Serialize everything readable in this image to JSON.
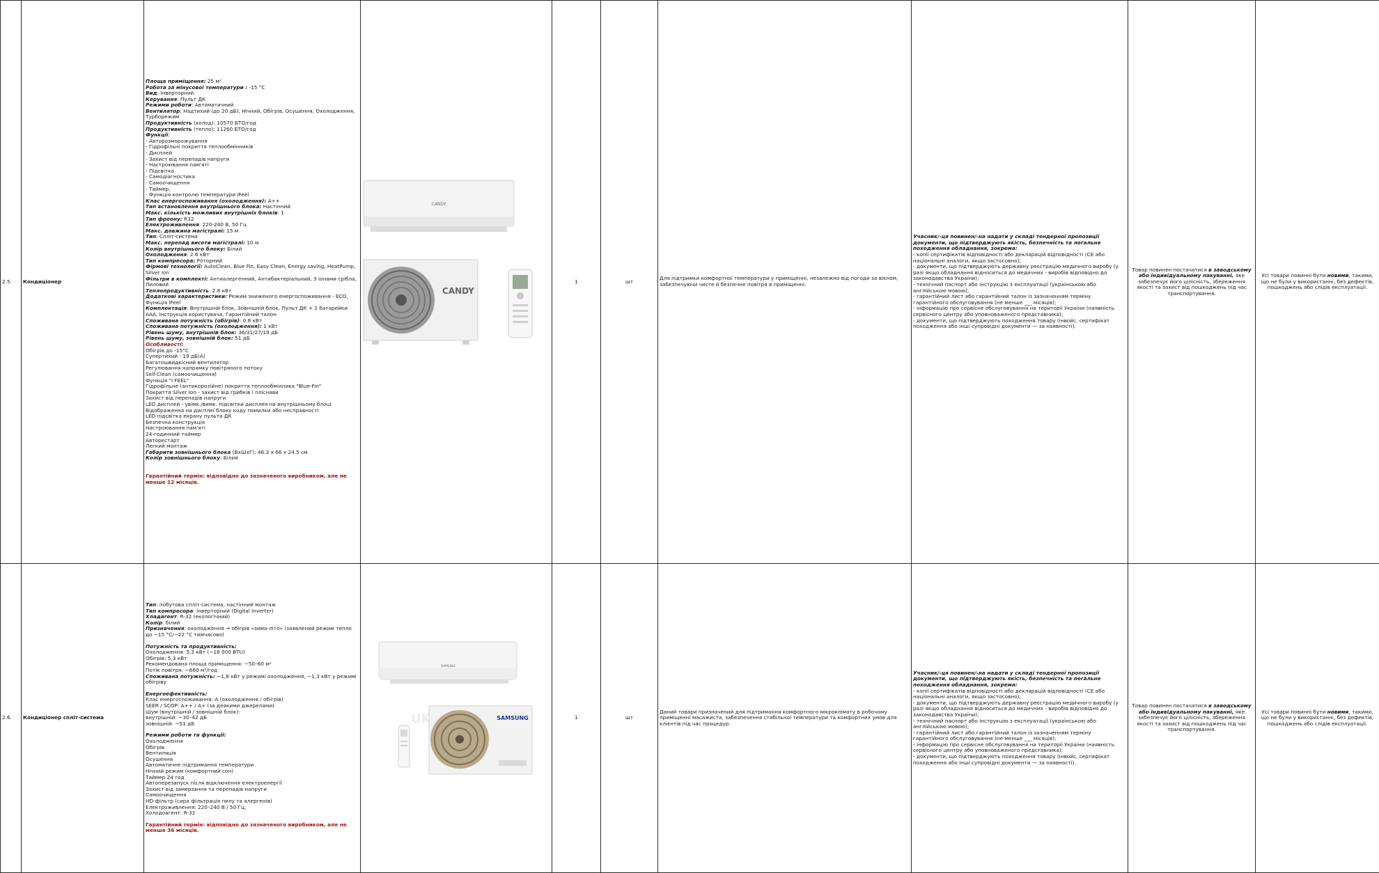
{
  "rows": [
    {
      "num": "2.5.",
      "name": "Кондиціонер",
      "qty": "1",
      "unit": "шт",
      "purpose": "Для підтримки комфортної температури у приміщенні, незалежно від погоди за вікном, забезпечуючи чисте й безпечне повітря в приміщенні.",
      "brand_label": "CANDY",
      "specs": [
        {
          "k": "Площа приміщення:",
          "v": " 25 м²"
        },
        {
          "k": "Робота за мінусової температури :",
          "v": " -15 °C"
        },
        {
          "k": "Вид",
          "v": ": Інверторний"
        },
        {
          "k": "Керування",
          "v": ": Пульт ДК"
        },
        {
          "k": "Режими роботи",
          "v": ": Автоматичний"
        },
        {
          "k": "Вентилятор",
          "v": ": Надтихий (до 20 дБ), Нічний, Обігрів, Осушення, Охолодження, Турборежим"
        },
        {
          "k": "Продуктивність",
          "v": " (холод): 10570 БТО/год"
        },
        {
          "k": "Продуктивність",
          "v": " (тепло): 11260 БТО/год"
        },
        {
          "k": "Функції",
          "v": ":"
        },
        {
          "k": "",
          "v": "- Авторозморожування"
        },
        {
          "k": "",
          "v": "- Гідрофільні покриття теплообмінників"
        },
        {
          "k": "",
          "v": "- Дисплей"
        },
        {
          "k": "",
          "v": "- Захист від перепадів напруги"
        },
        {
          "k": "",
          "v": "- Настроювання пам'яті"
        },
        {
          "k": "",
          "v": "- Підсвітка"
        },
        {
          "k": "",
          "v": "- Самодіагностика"
        },
        {
          "k": "",
          "v": "- Самоочищення"
        },
        {
          "k": "",
          "v": "- Таймер,"
        },
        {
          "k": "",
          "v": "- Функція контролю температури iFeel"
        },
        {
          "k": "Клас енергоспоживання (охолодження):",
          "v": " A++"
        },
        {
          "k": "Тип встановлення внутрішнього блока:",
          "v": " Настінний"
        },
        {
          "k": "Макс. кількість можливих внутрішніх блоків",
          "v": ": 1"
        },
        {
          "k": "Тип фреону:",
          "v": " R32"
        },
        {
          "k": "Електроживлення",
          "v": ": 220-240 В, 50 Гц"
        },
        {
          "k": "Макс. довжина магістралі:",
          "v": " 15 м"
        },
        {
          "k": "Тип",
          "v": ": Спліт-система"
        },
        {
          "k": "Макс. перепад висоти магістралі:",
          "v": " 10 м"
        },
        {
          "k": "Колір внутрішнього блоку:",
          "v": " Білий"
        },
        {
          "k": "Охолодження",
          "v": ": 2.6 кВт"
        },
        {
          "k": "Тип компресора:",
          "v": " Роторний"
        },
        {
          "k": "Фірмові технології:",
          "v": " AutoClean, Blue Fin, Easy Clean, Energy saving, HeatPump, Silver Ion"
        },
        {
          "k": "Фільтри в комплекті:",
          "v": " Антиалергенний, Антибактеріальний, З іонами срібла, Пиловий"
        },
        {
          "k": "Теплопродуктивність",
          "v": ": 2.8 кВт"
        },
        {
          "k": "Додаткові характеристики:",
          "v": " Режим зниженого енергоспоживання - ECO, Функція iFeel"
        },
        {
          "k": "Комплектація",
          "v": ": Внутрішній блок, Зовнішній блок, Пульт ДК + 2 батарейки ААА, Інструкція користувача, Гарантійний талон"
        },
        {
          "k": "Споживана потужність (обігрів)",
          "v": ": 0.8 кВт"
        },
        {
          "k": "Споживана потужність (охолодження):",
          "v": " 1 кВт"
        },
        {
          "k": "Рівень шуму, внутрішній блок:",
          "v": " 36/31/27/19 дБ"
        },
        {
          "k": "Рівень шуму, зовнішній блок:",
          "v": " 51 дБ"
        }
      ],
      "features_title": "Особливості:",
      "features": [
        "Обігрів до -15°C",
        "Супертихий - 19 дБ(А)",
        "Багатошвидкісний вентилятор",
        "Регулювання напрямку повітряного потоку",
        "Self-Clean (самоочищення)",
        "Функція \"I FEEL\"",
        "Гідрофільне (антикорозійне) покриття теплообмінника \"Blue-Fin\"",
        "Покриття Silver Ion - захист від грибків і плісняви",
        "Захист від перепадів напруги",
        "LED дисплей - увімк./вимк. підсвітки дисплея на внутрішньому блоці",
        "Відображення на дисплеї блоку коду помилки або несправності",
        "LED підсвітка екрану пульта ДК",
        "Безпечна конструкція",
        "Настроювання пам'яті",
        "24-годинний таймер",
        "Авторестарт",
        "Легкий монтаж"
      ],
      "tail_specs": [
        {
          "k": "Габарити зовнішнього блока",
          "v": " (ВхШхГ): 46.3 x 66 x 24.5 см"
        },
        {
          "k": "Колір зовнішнього блоку",
          "v": ": Білий"
        }
      ],
      "warranty": "Гарантійний термін: відповідно до зазначеного виробником, але не менше 12 місяців."
    },
    {
      "num": "2.6.",
      "name": "Кондиціонер спліт-система",
      "qty": "1",
      "unit": "шт",
      "purpose": "Даний товари призначений для підтримання комфортного мікроклімату в робочому приміщенні масажиста, забезпечення стабільної температури та комфортних умов для клієнтів під час процедур.",
      "brand_label": "SAMSUNG",
      "watermark": "UKR",
      "specs_a": [
        {
          "k": "Тип",
          "v": ": побутова спліт-система, настінний монтаж"
        },
        {
          "k": "Тип компресора",
          "v": ": інверторний (Digital Inverter)"
        },
        {
          "k": "Хладагент",
          "v": ": R-32 (екологічний)"
        },
        {
          "k": "Колір",
          "v": ": білий"
        },
        {
          "k": "Призначення",
          "v": ": охолодження → обігрів «зима-літо» (заявлений режим тепло до −15 °C/−22 °C тимчасово)"
        }
      ],
      "perf_title": "Потужність та продуктивність:",
      "perf_lines": [
        "Охолодження: 5,3 кВт (~18 000 BTU)",
        "Обігрів: 5,3 кВт",
        "Рекомендована площа приміщення: ~50–60 м²",
        "Потік повітря: ~660 м³/год"
      ],
      "perf_power": {
        "k": "Споживана потужність:",
        "v": " ~1,8 кВт у режимі охолодження, ~1,3 кВт у режимі обігріву"
      },
      "energy_title": "Енергоефективність:",
      "energy_lines": [
        "Клас енергоспоживання: A (охолодження / обігрів)",
        "SEER / SCOP: A++ / A+ (за деякими джерелами)",
        "Шум (внутрішній / зовнішній блок):",
        "внутрішній: ~30–42 дБ",
        "зовнішній: ~51 дБ"
      ],
      "modes_title": "Режими роботи та функції:",
      "modes_lines": [
        "Охолодження",
        "Обігрів",
        "Вентиляція",
        "Осушення",
        "Автоматичне підтримання температури",
        "Нічний режим (комфортний сон)",
        "Таймер 24 год",
        "Автоперезапуск після відключення електроенергії",
        "Захист від замерзання та перепадів напруги",
        "Самоочищення",
        "HD-фільтр (сира фільтрація пилу та алергенів)",
        "Електроживлення: 220–240 В / 50 Гц;",
        "Холодоагент: R-32"
      ],
      "warranty": "Гарантійний термін: відповідно до зазначеного виробником, але не менше 36 місяців."
    }
  ],
  "docs_intro": "Учасник/-ця повинен/-на надати у складі тендерної пропозиції документи, що підтверджують якість, безпечність та легальне походження обладнання, зокрема:",
  "docs_lines": [
    "- копії сертифікатів відповідності або декларацій відповідності (CE або національні аналоги, якщо застосовно);",
    "- документи, що підтверджують державну реєстрацію медичного виробу (у разі якщо обладнання відноситься до медичних - виробів відповідно до законодавства України);",
    "- технічний паспорт або інструкцію з експлуатації (українською або англійською мовою);",
    "- гарантійний лист або гарантійний талон із зазначенням терміну гарантійного обслуговування (не менше ___ місяців);",
    "- інформацію про сервісне обслуговування на території України (наявність сервісного центру або уповноваженого представника);",
    "- документи, що підтверджують походження товару (інвойс, сертифікат походження або інші супровідні документи — за наявності)."
  ],
  "packaging_a": "Товар повинен постачатися ",
  "packaging_b": "в заводському або індивідуальному пакуванні,",
  "packaging_c": " яке забезпечує його цілісність, збереження якості та захист від пошкоджень під час транспортування.",
  "condition_a": "Усі товари повинні бути ",
  "condition_b": "новими",
  "condition_c": ", такими, що не були у використанні, без дефектів, пошкоджень або слідів експлуатації.",
  "colors": {
    "border": "#2b2b2b",
    "warranty": "#b01010",
    "samsung": "#1f3a8a"
  }
}
